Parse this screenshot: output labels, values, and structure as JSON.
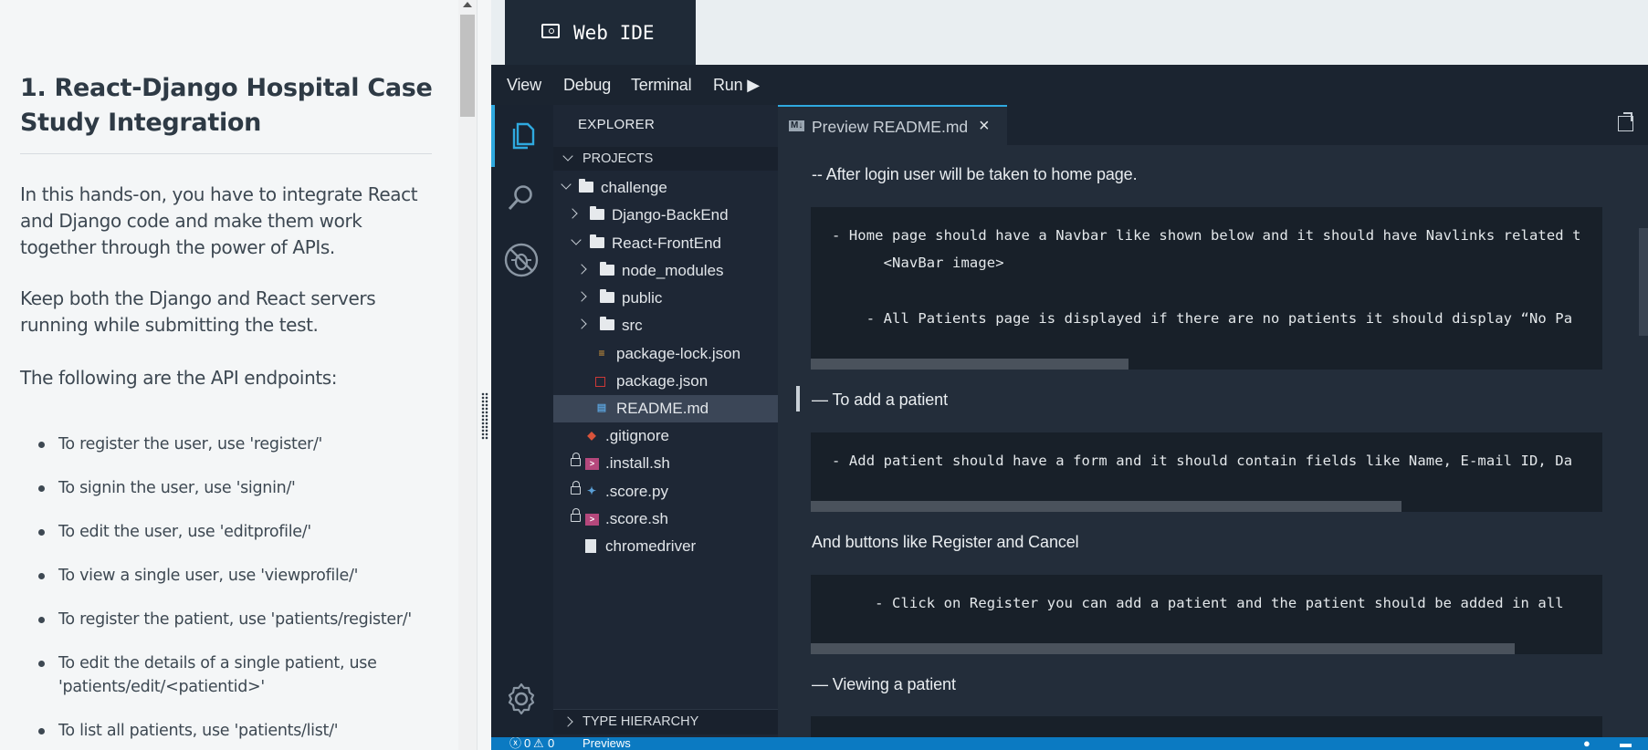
{
  "instructions": {
    "title": "1. React-Django Hospital Case Study Integration",
    "intro": "In this hands-on, you have to integrate React and Django code and make them work together through the power of APIs.",
    "keep_running": "Keep both the Django and React servers running while submitting the test.",
    "endpoints_heading": "The following are the API endpoints:",
    "endpoints": [
      "To register the user, use 'register/'",
      "To signin the user, use 'signin/'",
      "To edit the user, use 'editprofile/'",
      "To view a single user, use 'viewprofile/'",
      "To register the patient, use 'patients/register/'",
      "To edit the details of a single patient, use 'patients/edit/<patientid>'",
      "To list all patients, use 'patients/list/'"
    ]
  },
  "ide": {
    "tab_title": "Web IDE",
    "menu": [
      "View",
      "Debug",
      "Terminal",
      "Run ▶"
    ],
    "activity_icons": [
      "files-icon",
      "search-icon",
      "debug-icon",
      "gear-icon"
    ],
    "accent_color": "#2fa9df",
    "statusbar_color": "#0b7ac2"
  },
  "explorer": {
    "title": "EXPLORER",
    "section": "PROJECTS",
    "bottom_section": "TYPE HIERARCHY",
    "tree": {
      "challenge": "challenge",
      "backend": "Django-BackEnd",
      "frontend": "React-FrontEnd",
      "node_modules": "node_modules",
      "public": "public",
      "src": "src",
      "package_lock": "package-lock.json",
      "package_json": "package.json",
      "readme": "README.md",
      "gitignore": ".gitignore",
      "install": ".install.sh",
      "score_py": ".score.py",
      "score_sh": ".score.sh",
      "chromedriver": "chromedriver"
    }
  },
  "editor": {
    "tab_label": "Preview README.md",
    "tab_badge": "M↓",
    "close": "×",
    "content": {
      "p1": "-- After login user will be taken to home page.",
      "code1": [
        "- Home page should have a Navbar like shown below and it should have Navlinks related t",
        "      <NavBar image>",
        "",
        "    - All Patients page is displayed if there are no patients it should display “No Pa"
      ],
      "p2": "— To add a patient",
      "code2": [
        "- Add patient should have a form and it should contain fields like Name, E-mail ID, Da"
      ],
      "p3": "And buttons like Register and Cancel",
      "code3": [
        "     - Click on Register you can add a patient and the patient should be added in all"
      ],
      "p4": "— Viewing a patient"
    }
  },
  "status": {
    "errors": "0",
    "warnings": "0",
    "previews": "Previews"
  }
}
